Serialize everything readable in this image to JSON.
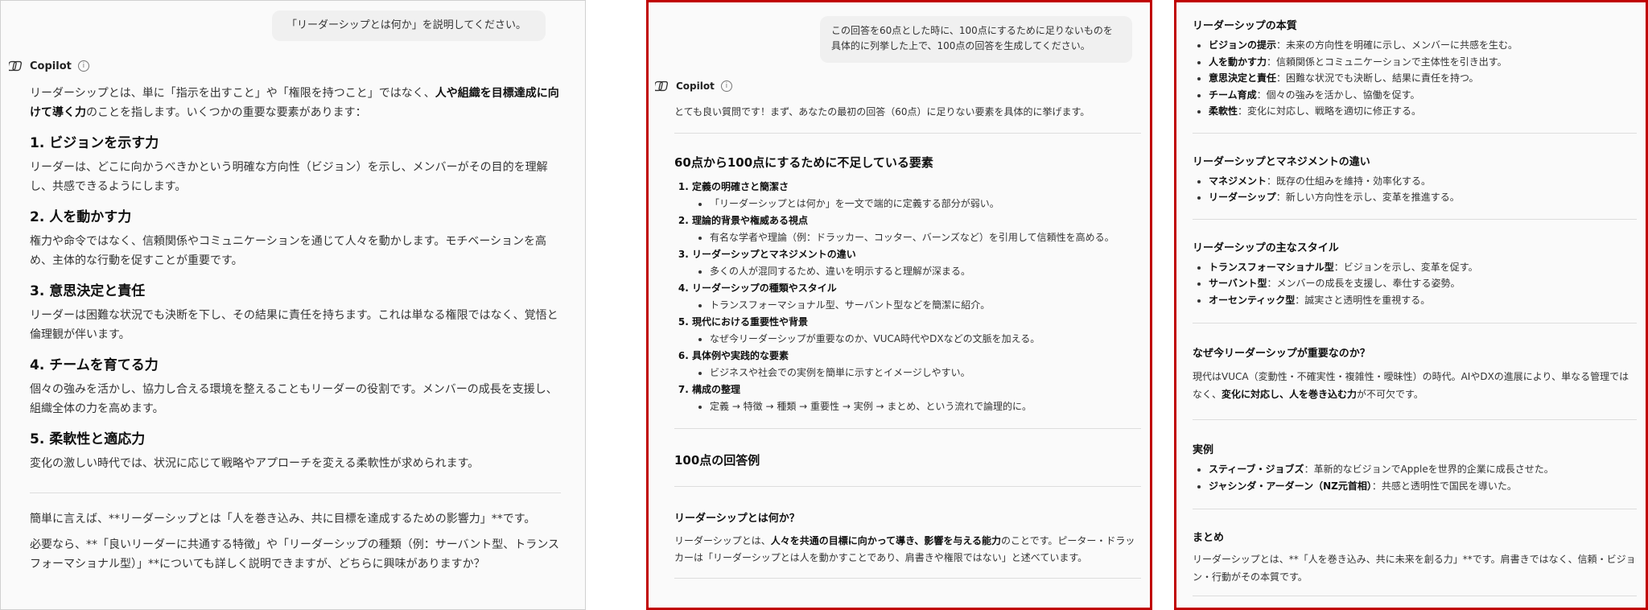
{
  "panel1": {
    "user_message": "「リーダーシップとは何か」を説明してください。",
    "copilot_name": "Copilot",
    "intro": {
      "pre": "リーダーシップとは、単に「指示を出すこと」や「権限を持つこと」ではなく、",
      "bold": "人や組織を目標達成に向けて導く力",
      "post": "のことを指します。いくつかの重要な要素があります："
    },
    "sections": [
      {
        "heading": "1. ビジョンを示す力",
        "body": "リーダーは、どこに向かうべきかという明確な方向性（ビジョン）を示し、メンバーがその目的を理解し、共感できるようにします。"
      },
      {
        "heading": "2. 人を動かす力",
        "body": "権力や命令ではなく、信頼関係やコミュニケーションを通じて人々を動かします。モチベーションを高め、主体的な行動を促すことが重要です。"
      },
      {
        "heading": "3. 意思決定と責任",
        "body": "リーダーは困難な状況でも決断を下し、その結果に責任を持ちます。これは単なる権限ではなく、覚悟と倫理観が伴います。"
      },
      {
        "heading": "4. チームを育てる力",
        "body": "個々の強みを活かし、協力し合える環境を整えることもリーダーの役割です。メンバーの成長を支援し、組織全体の力を高めます。"
      },
      {
        "heading": "5. 柔軟性と適応力",
        "body": "変化の激しい時代では、状況に応じて戦略やアプローチを変える柔軟性が求められます。"
      }
    ],
    "summary": "簡単に言えば、**リーダーシップとは「人を巻き込み、共に目標を達成するための影響力」**です。",
    "followup": "必要なら、**「良いリーダーに共通する特徴」や「リーダーシップの種類（例：サーバント型、トランスフォーマショナル型）」**についても詳しく説明できますが、どちらに興味がありますか？"
  },
  "panel2": {
    "user_message": "この回答を60点とした時に、100点にするために足りないものを具体的に列挙した上で、100点の回答を生成してください。",
    "copilot_name": "Copilot",
    "intro": "とても良い質問です！まず、あなたの最初の回答（60点）に足りない要素を具体的に挙げます。",
    "gap_heading": "60点から100点にするために不足している要素",
    "gaps": [
      {
        "title": "定義の明確さと簡潔さ",
        "detail": "「リーダーシップとは何か」を一文で端的に定義する部分が弱い。"
      },
      {
        "title": "理論的背景や権威ある視点",
        "detail": "有名な学者や理論（例：ドラッカー、コッター、バーンズなど）を引用して信頼性を高める。"
      },
      {
        "title": "リーダーシップとマネジメントの違い",
        "detail": "多くの人が混同するため、違いを明示すると理解が深まる。"
      },
      {
        "title": "リーダーシップの種類やスタイル",
        "detail": "トランスフォーマショナル型、サーバント型などを簡潔に紹介。"
      },
      {
        "title": "現代における重要性や背景",
        "detail": "なぜ今リーダーシップが重要なのか、VUCA時代やDXなどの文脈を加える。"
      },
      {
        "title": "具体例や実践的な要素",
        "detail": "ビジネスや社会での実例を簡単に示すとイメージしやすい。"
      },
      {
        "title": "構成の整理",
        "detail": "定義 → 特徴 → 種類 → 重要性 → 実例 → まとめ、という流れで論理的に。"
      }
    ],
    "answer_heading": "100点の回答例",
    "what_heading": "リーダーシップとは何か？",
    "what_pre": "リーダーシップとは、",
    "what_bold": "人々を共通の目標に向かって導き、影響を与える能力",
    "what_post": "のことです。ピーター・ドラッカーは「リーダーシップとは人を動かすことであり、肩書きや権限ではない」と述べています。"
  },
  "panel3": {
    "essence": {
      "heading": "リーダーシップの本質",
      "items": [
        {
          "term": "ビジョンの提示",
          "desc": "：未来の方向性を明確に示し、メンバーに共感を生む。"
        },
        {
          "term": "人を動かす力",
          "desc": "：信頼関係とコミュニケーションで主体性を引き出す。"
        },
        {
          "term": "意思決定と責任",
          "desc": "：困難な状況でも決断し、結果に責任を持つ。"
        },
        {
          "term": "チーム育成",
          "desc": "：個々の強みを活かし、協働を促す。"
        },
        {
          "term": "柔軟性",
          "desc": "：変化に対応し、戦略を適切に修正する。"
        }
      ]
    },
    "vs_mgmt": {
      "heading": "リーダーシップとマネジメントの違い",
      "items": [
        {
          "term": "マネジメント",
          "desc": "：既存の仕組みを維持・効率化する。"
        },
        {
          "term": "リーダーシップ",
          "desc": "：新しい方向性を示し、変革を推進する。"
        }
      ]
    },
    "styles": {
      "heading": "リーダーシップの主なスタイル",
      "items": [
        {
          "term": "トランスフォーマショナル型",
          "desc": "：ビジョンを示し、変革を促す。"
        },
        {
          "term": "サーバント型",
          "desc": "：メンバーの成長を支援し、奉仕する姿勢。"
        },
        {
          "term": "オーセンティック型",
          "desc": "：誠実さと透明性を重視する。"
        }
      ]
    },
    "why_now": {
      "heading": "なぜ今リーダーシップが重要なのか？",
      "text1": "現代はVUCA（変動性・不確実性・複雑性・曖昧性）の時代。AIやDXの進展により、単なる管理ではなく、",
      "bold": "変化に対応し、人を巻き込む力",
      "text2": "が不可欠です。"
    },
    "examples": {
      "heading": "実例",
      "items": [
        {
          "term": "スティーブ・ジョブズ",
          "desc": "：革新的なビジョンでAppleを世界的企業に成長させた。"
        },
        {
          "term": "ジャシンダ・アーダーン（NZ元首相）",
          "desc": "：共感と透明性で国民を導いた。"
        }
      ]
    },
    "conclusion": {
      "heading": "まとめ",
      "text": "リーダーシップとは、**「人を巻き込み、共に未来を創る力」**です。肩書きではなく、信頼・ビジョン・行動がその本質です。"
    }
  }
}
